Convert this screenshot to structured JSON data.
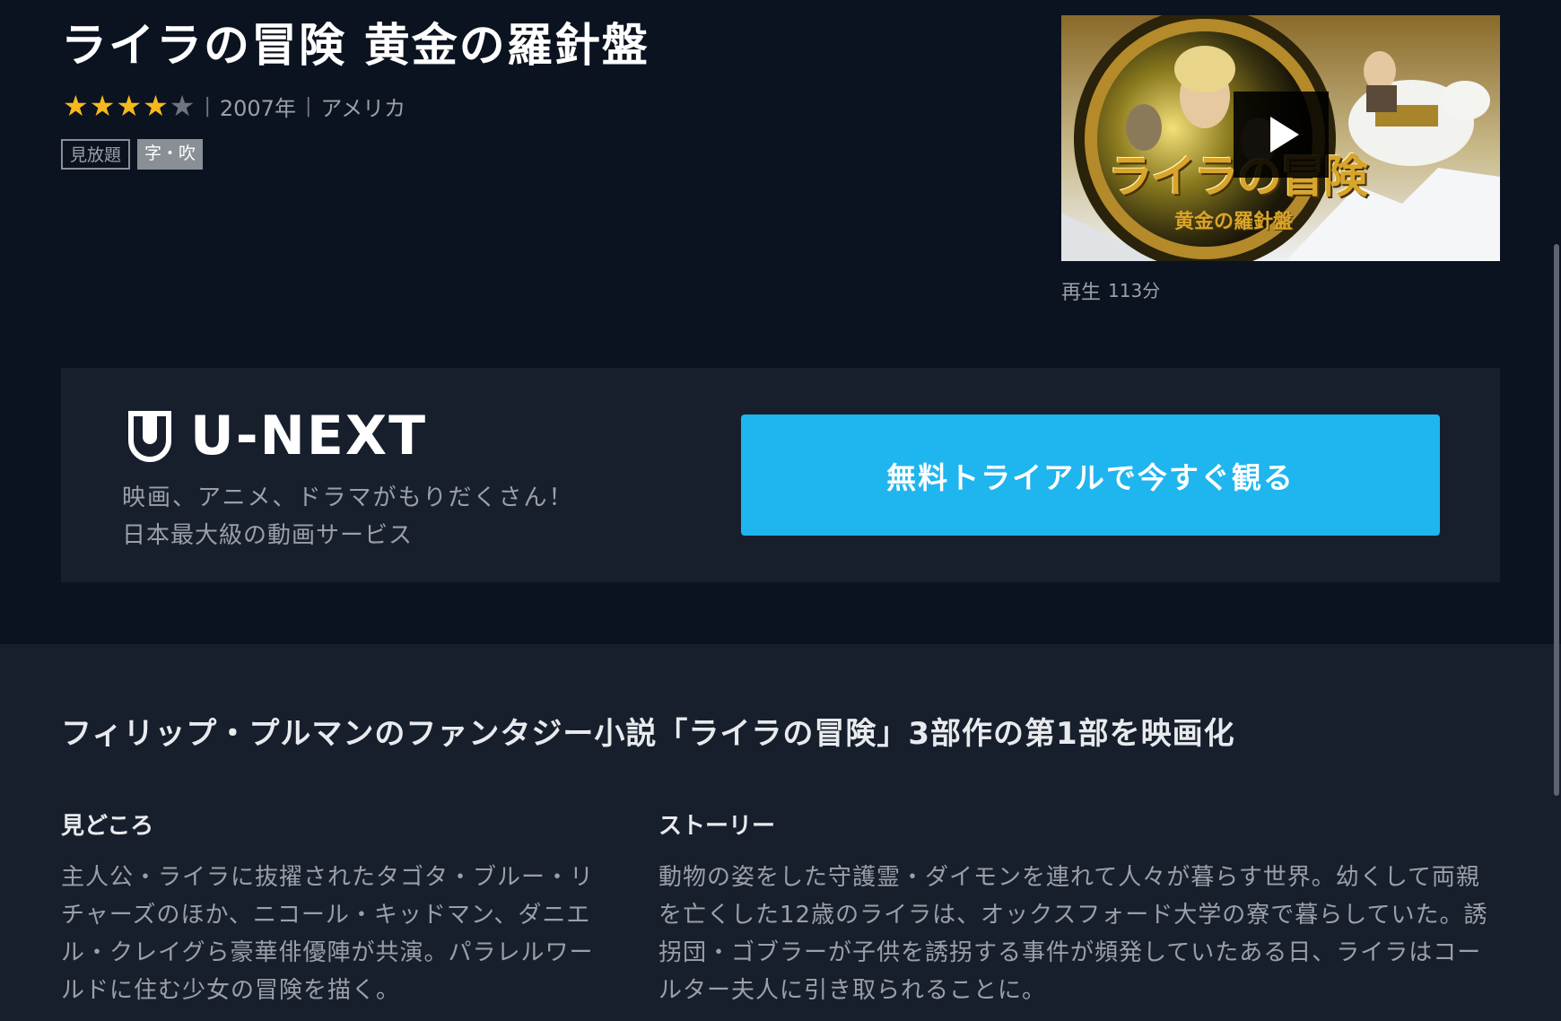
{
  "title": "ライラの冒険 黄金の羅針盤",
  "rating": {
    "value": 4,
    "max": 5
  },
  "meta": {
    "year": "2007年",
    "country": "アメリカ"
  },
  "badges": {
    "unlimited": "見放題",
    "audio": "字・吹"
  },
  "thumbnail": {
    "poster_title": "ライラの冒険",
    "poster_subtitle": "黄金の羅針盤",
    "play_label": "再生",
    "duration": "113分"
  },
  "promo": {
    "logo_text": "U-NEXT",
    "line1": "映画、アニメ、ドラマがもりだくさん！",
    "line2": "日本最大級の動画サービス",
    "cta_label": "無料トライアルで今すぐ観る"
  },
  "description": {
    "tagline": "フィリップ・プルマンのファンタジー小説「ライラの冒険」3部作の第1部を映画化",
    "highlights_heading": "見どころ",
    "highlights_body": "主人公・ライラに抜擢されたタゴタ・ブルー・リチャーズのほか、ニコール・キッドマン、ダニエル・クレイグら豪華俳優陣が共演。パラレルワールドに住む少女の冒険を描く。",
    "story_heading": "ストーリー",
    "story_body": "動物の姿をした守護霊・ダイモンを連れて人々が暮らす世界。幼くして両親を亡くした12歳のライラは、オックスフォード大学の寮で暮らしていた。誘拐団・ゴブラーが子供を誘拐する事件が頻発していたある日、ライラはコールター夫人に引き取られることに。"
  },
  "colors": {
    "background": "#0b1320",
    "panel": "#171f2d",
    "accent": "#1fb5ee",
    "star": "#f6b91d"
  },
  "icons": {
    "play": "play-icon",
    "logo": "shield-icon",
    "star": "star-icon"
  }
}
